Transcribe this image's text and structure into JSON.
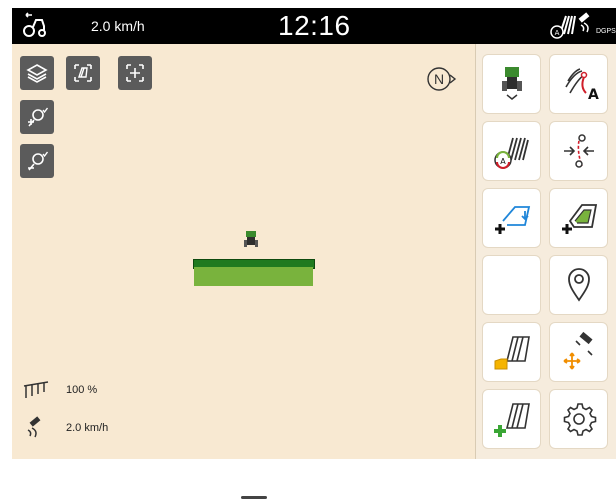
{
  "topbar": {
    "icons": [
      "tractor-icon",
      "section-control-icon",
      "satellite-icon"
    ],
    "speed": "2.0 km/h",
    "time": "12:16",
    "gps_label": "DGPS"
  },
  "map": {
    "compass_label": "N",
    "buttons": [
      "layers-icon",
      "field-view-icon",
      "center-view-icon",
      "zoom-in-icon",
      "zoom-out-icon"
    ],
    "status": {
      "application_rate": "100 %",
      "gps_speed": "2.0 km/h"
    }
  },
  "panel": {
    "buttons": [
      "vehicle-settings-icon",
      "track-line-a-icon",
      "section-control-auto-icon",
      "track-shift-icon",
      "add-field-boundary-icon",
      "add-headland-icon",
      "empty-slot",
      "location-pin-icon",
      "open-field-icon",
      "move-gps-icon",
      "new-field-icon",
      "settings-gear-icon"
    ]
  },
  "colors": {
    "top_bar": "#000000",
    "map_background": "#f8e9d2",
    "panel_background": "#f6ecdd",
    "accent_green": "#79b33d",
    "dark_green": "#1f7a1f",
    "blue_accent": "#1f86d9",
    "orange_accent": "#f18e00"
  }
}
